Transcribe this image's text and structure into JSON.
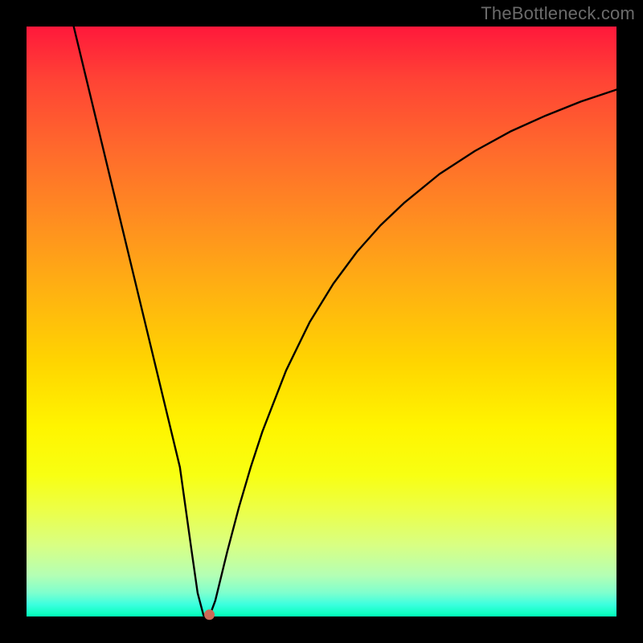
{
  "watermark": "TheBottleneck.com",
  "chart_data": {
    "type": "line",
    "title": "",
    "xlabel": "",
    "ylabel": "",
    "xlim": [
      0,
      100
    ],
    "ylim": [
      0,
      100
    ],
    "grid": false,
    "series": [
      {
        "name": "curve",
        "x": [
          8,
          10,
          12,
          14,
          16,
          18,
          20,
          22,
          24,
          26,
          28,
          29,
          30,
          31,
          32,
          34,
          36,
          38,
          40,
          44,
          48,
          52,
          56,
          60,
          64,
          70,
          76,
          82,
          88,
          94,
          100
        ],
        "y": [
          100,
          91.7,
          83.4,
          75.1,
          66.8,
          58.5,
          50.2,
          41.9,
          33.6,
          25.3,
          11.0,
          4.0,
          0.2,
          0.0,
          2.7,
          10.9,
          18.5,
          25.3,
          31.4,
          41.7,
          49.9,
          56.4,
          61.8,
          66.3,
          70.1,
          75.0,
          78.9,
          82.2,
          84.9,
          87.3,
          89.3
        ]
      }
    ],
    "marker": {
      "x": 31,
      "y": 0.3,
      "radius_px": 6.5
    },
    "gradient_note": "background vertical gradient from red (top) through orange/yellow to green (bottom)"
  },
  "layout": {
    "image_size": 800,
    "plot_inset": 33,
    "plot_size": 734
  }
}
